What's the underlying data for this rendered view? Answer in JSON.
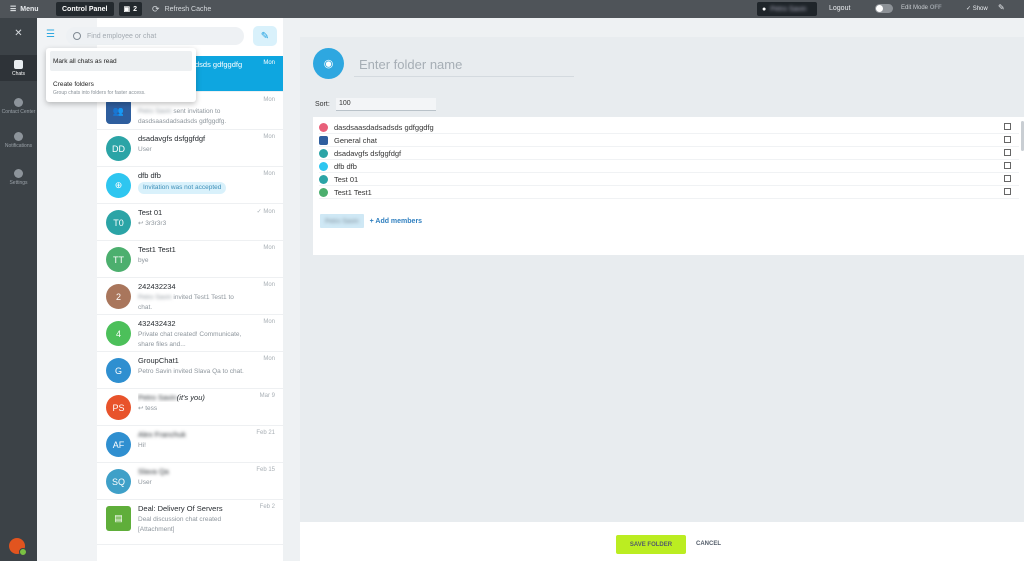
{
  "topbar": {
    "menu_label": "Menu",
    "control_panel_label": "Control Panel",
    "badge_count": "2",
    "refresh_label": "Refresh Cache",
    "user_name": "Petro Savin",
    "logout_label": "Logout",
    "edit_mode_label": "Edit Mode",
    "edit_mode_state": "OFF",
    "show_label": "Show"
  },
  "rail": {
    "items": [
      {
        "label": "Chats",
        "icon": "chats-icon"
      },
      {
        "label": "Contact Center",
        "icon": "contact-center-icon"
      },
      {
        "label": "Notifications",
        "icon": "bell-icon"
      },
      {
        "label": "Settings",
        "icon": "gear-icon"
      }
    ]
  },
  "search": {
    "placeholder": "Find employee or chat"
  },
  "dropdown": {
    "item1": "Mark all chats as read",
    "item2": "Create folders",
    "item2_desc": "Group chats into folders for faster access."
  },
  "chats": [
    {
      "title": "dsds gdfggdfg",
      "sub": "",
      "time": "Mon",
      "initials": "",
      "color": "#0ea6e0"
    },
    {
      "title": "",
      "sub_blur": "Petro Savin",
      "sub": "sent invitation to dasdsaasdadsadsds gdfggdfg.",
      "time": "Mon",
      "initials": "",
      "color": "#2e5e9e"
    },
    {
      "title": "dsadavgfs dsfggfdgf",
      "sub": "User",
      "time": "Mon",
      "initials": "DD",
      "color": "#2ba4a6"
    },
    {
      "title": "dfb dfb",
      "sub": "Invitation was not accepted",
      "time": "Mon",
      "initials": "",
      "color": "#2ec6f0"
    },
    {
      "title": "Test 01",
      "sub": "↩ 3r3r3r3",
      "time": "✓ Mon",
      "initials": "T0",
      "color": "#2ba4a6"
    },
    {
      "title": "Test1 Test1",
      "sub": "bye",
      "time": "Mon",
      "initials": "TT",
      "color": "#4caf6e"
    },
    {
      "title": "242432234",
      "sub_blur": "Petro Savin",
      "sub": "invited Test1 Test1 to chat.",
      "time": "Mon",
      "initials": "2",
      "color": "#a9765c"
    },
    {
      "title": "432432432",
      "sub": "Private chat created! Communicate, share files and...",
      "time": "Mon",
      "initials": "4",
      "color": "#4cc05a"
    },
    {
      "title": "GroupChat1",
      "sub": "Petro Savin invited Slava Qa to chat.",
      "time": "Mon",
      "initials": "G",
      "color": "#2f8fd0"
    },
    {
      "title": "Petro Savin",
      "title_suffix": "(it's you)",
      "sub": "↩ tess",
      "time": "Mar 9",
      "initials": "PS",
      "color": "#e8532b"
    },
    {
      "title": "Alex Franchuk",
      "sub": "Hi!",
      "time": "Feb 21",
      "initials": "AF",
      "color": "#2f8fd0"
    },
    {
      "title": "Slava Qa",
      "sub": "User",
      "time": "Feb 15",
      "initials": "SQ",
      "color": "#3fa0c8"
    },
    {
      "title": "Deal: Delivery Of Servers",
      "sub": "Deal discussion chat created [Attachment]",
      "time": "Feb 2",
      "initials": "",
      "color": "#5fae3a"
    }
  ],
  "folder": {
    "name_placeholder": "Enter folder name",
    "sort_label": "Sort:",
    "sort_value": "100",
    "members": [
      {
        "name": "dasdsaasdadsadsds gdfggdfg",
        "color": "#e8607a"
      },
      {
        "name": "General chat",
        "color": "#2e5e9e"
      },
      {
        "name": "dsadavgfs dsfggfdgf",
        "color": "#2ba4a6"
      },
      {
        "name": "dfb dfb",
        "color": "#2ec6f0"
      },
      {
        "name": "Test 01",
        "color": "#2ba4a6"
      },
      {
        "name": "Test1 Test1",
        "color": "#4caf6e"
      }
    ],
    "member_chip": "Petro Savin",
    "add_members_label": "+ Add members"
  },
  "footer": {
    "save_label": "SAVE FOLDER",
    "cancel_label": "CANCEL"
  }
}
